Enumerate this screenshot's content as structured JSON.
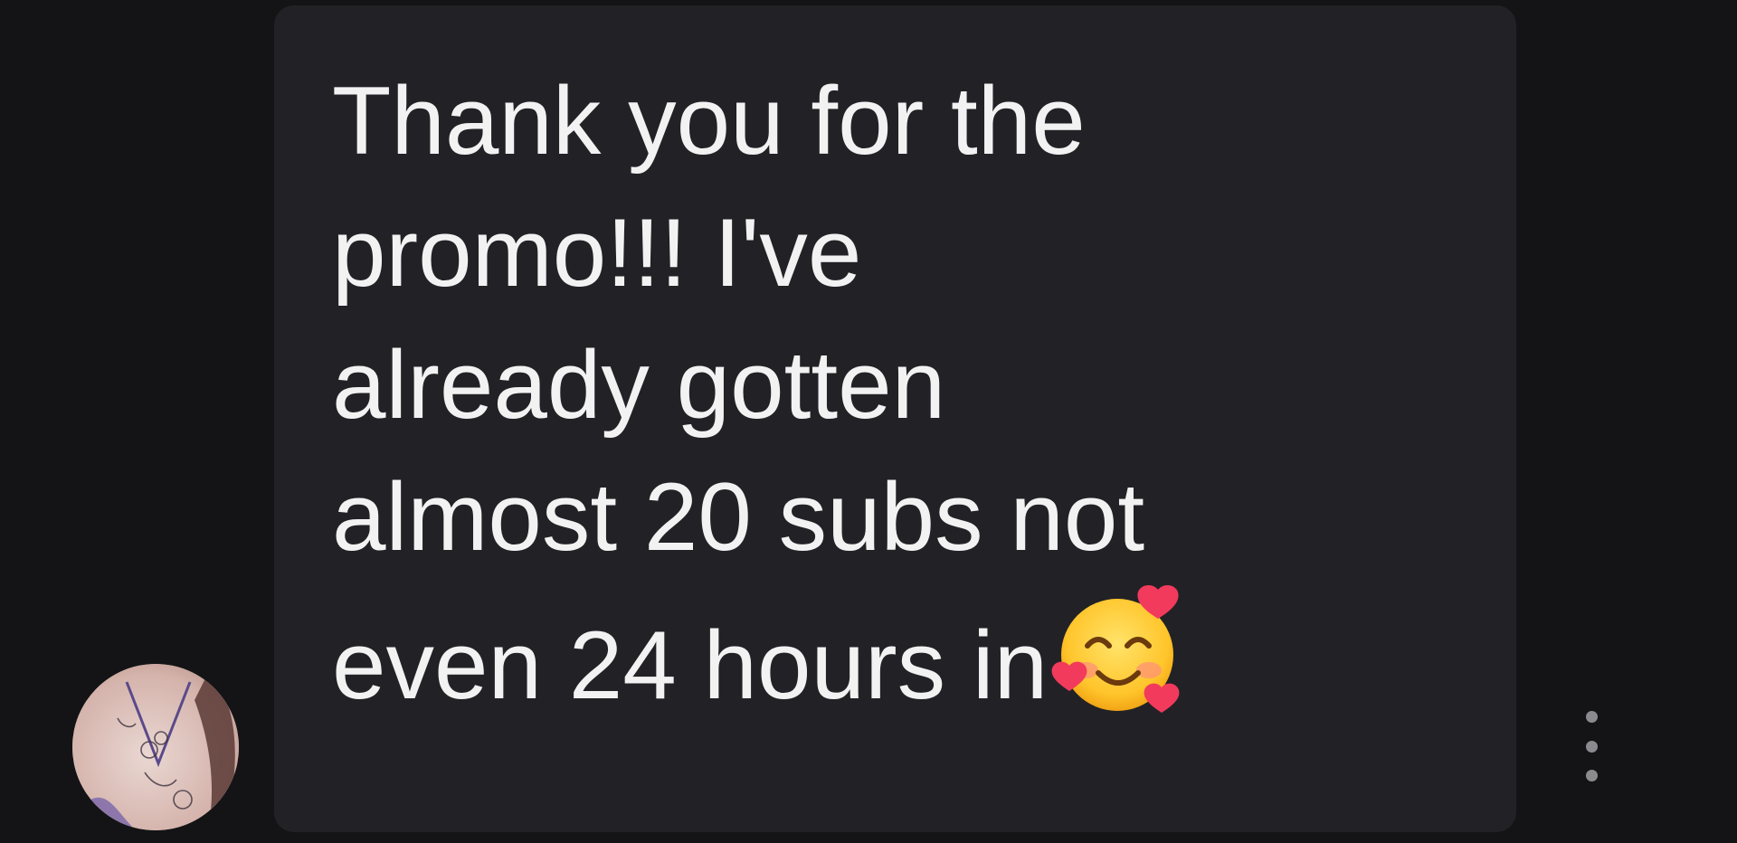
{
  "message": {
    "text": "Thank you for the\npromo!!! I've\nalready gotten\nalmost 20 subs not\neven 24 hours in",
    "emoji_icon": "smiling-face-with-hearts"
  },
  "colors": {
    "background": "#141416",
    "bubble": "#222226",
    "text": "#f2f2f2",
    "more_dots": "#8b8b8f"
  },
  "icons": {
    "avatar": "user-avatar",
    "more": "more-vertical-icon"
  }
}
